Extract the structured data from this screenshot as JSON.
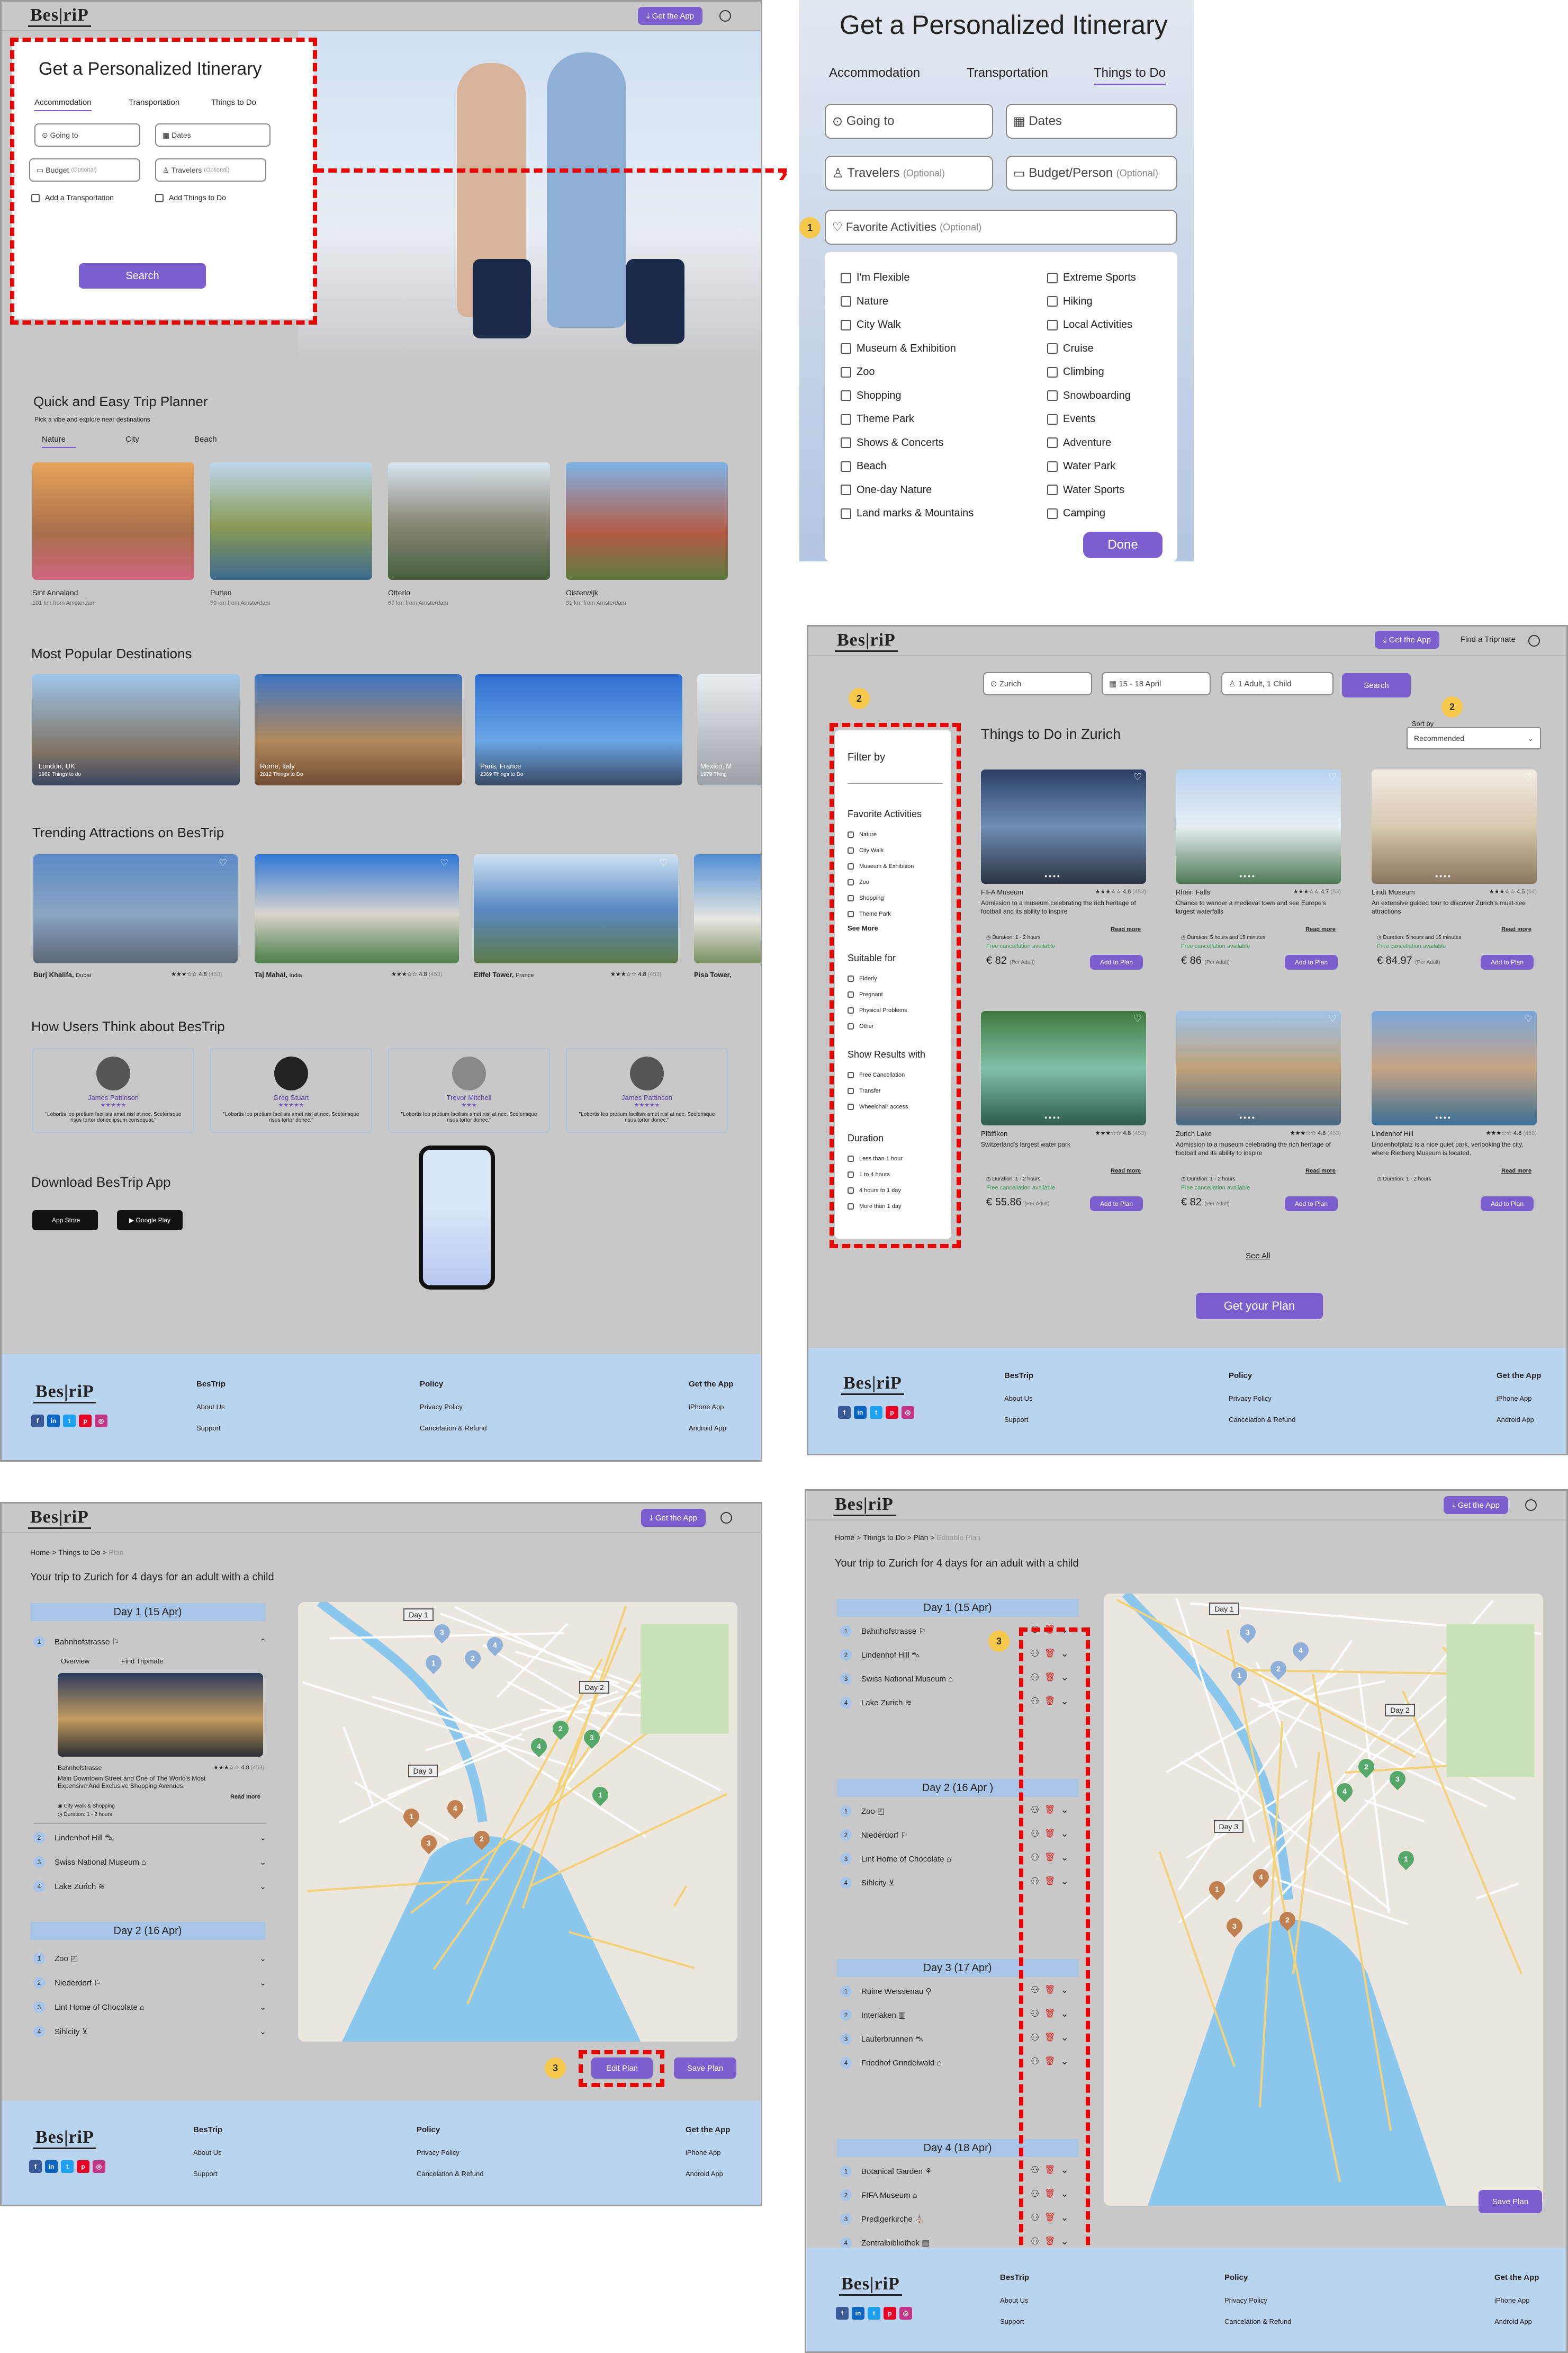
{
  "brand": {
    "logo": "Bes|riP",
    "accent": "#7b5fce",
    "light_blue": "#bad3ef"
  },
  "header": {
    "get_app": "Get the App",
    "find_tripmate": "Find a Tripmate"
  },
  "footer": {
    "col1_title": "BesTrip",
    "about": "About Us",
    "support": "Support",
    "col2_title": "Policy",
    "privacy": "Privacy Policy",
    "cancel": "Cancelation & Refund",
    "col3_title": "Get the App",
    "iphone": "iPhone App",
    "android": "Android App"
  },
  "home": {
    "itinerary_title": "Get a Personalized Itinerary",
    "tabs": [
      "Accommodation",
      "Transportation",
      "Things to Do"
    ],
    "going_to": "Going to",
    "dates": "Dates",
    "budget": "Budget",
    "budget_opt": "(Optional)",
    "travelers": "Travelers",
    "travelers_opt": "(Optional)",
    "add_transport": "Add a Transportation",
    "add_things": "Add Things to Do",
    "search": "Search",
    "quick_title": "Quick and Easy Trip Planner",
    "quick_sub": "Pick a vibe and explore near destinations",
    "vibes": [
      "Nature",
      "City",
      "Beach"
    ],
    "nearby": [
      {
        "name": "Sint Annaland",
        "dist": "101 km from Amsterdam"
      },
      {
        "name": "Putten",
        "dist": "59 km from Amsterdam"
      },
      {
        "name": "Otterlo",
        "dist": "67 km from Amsterdam"
      },
      {
        "name": "Oisterwijk",
        "dist": "91 km from Amsterdam"
      }
    ],
    "popular_title": "Most Popular Destinations",
    "popular": [
      {
        "name": "London, UK",
        "sub": "1969 Things to do"
      },
      {
        "name": "Rome, Italy",
        "sub": "2812 Things to Do"
      },
      {
        "name": "Paris, France",
        "sub": "2369 Things to Do"
      },
      {
        "name": "Mexico, M",
        "sub": "1979 Thing"
      }
    ],
    "trending_title": "Trending Attractions on BesTrip",
    "trending": [
      {
        "name": "Burj Khalifa,",
        "place": "Dubai",
        "rating": "4.8",
        "count": "(453)"
      },
      {
        "name": "Taj Mahal,",
        "place": "India",
        "rating": "4.8",
        "count": "(453)"
      },
      {
        "name": "Eiffel Tower,",
        "place": "France",
        "rating": "4.8",
        "count": "(453)"
      },
      {
        "name": "Pisa Tower,",
        "place": "",
        "rating": "",
        "count": ""
      }
    ],
    "users_title": "How Users Think about BesTrip",
    "users": [
      {
        "name": "James Pattinson",
        "quote": "\"Lobortis leo pretium facilisis amet nisl at nec. Scelerisque risus tortor donec ipsum consequat.\""
      },
      {
        "name": "Greg Stuart",
        "quote": "\"Lobortis leo pretium facilisis amet nisl at nec. Scelerisque risus tortor donec.\""
      },
      {
        "name": "Trevor Mitchell",
        "quote": "\"Lobortis leo pretium facilisis amet nisl at nec. Scelerisque risus tortor donec.\""
      },
      {
        "name": "James Pattinson",
        "quote": "\"Lobortis leo pretium facilisis amet nisl at nec. Scelerisque risus tortor donec.\""
      }
    ],
    "download_title": "Download BesTrip App",
    "appstore": "App Store",
    "googleplay": "Google Play"
  },
  "zoom": {
    "title": "Get a Personalized Itinerary",
    "tabs": [
      "Accommodation",
      "Transportation",
      "Things to Do"
    ],
    "going_to": "Going to",
    "dates": "Dates",
    "travelers": "Travelers",
    "travelers_opt": "(Optional)",
    "budget": "Budget/Person",
    "budget_opt": "(Optional)",
    "fav": "Favorite Activities",
    "fav_opt": "(Optional)",
    "badge": "1",
    "left": [
      "I'm Flexible",
      "Nature",
      "City Walk",
      "Museum & Exhibition",
      "Zoo",
      "Shopping",
      "Theme Park",
      "Shows & Concerts",
      "Beach",
      "One-day Nature",
      "Land marks & Mountains"
    ],
    "right": [
      "Extreme Sports",
      "Hiking",
      "Local Activities",
      "Cruise",
      "Climbing",
      "Snowboarding",
      "Events",
      "Adventure",
      "Water Park",
      "Water Sports",
      "Camping"
    ],
    "done": "Done"
  },
  "things": {
    "search_place": "Zurich",
    "search_dates": "15 - 18 April",
    "search_people": "1 Adult, 1 Child",
    "search": "Search",
    "badge": "2",
    "sort_label": "Sort by",
    "sort_value": "Recommended",
    "filter_title": "Filter by",
    "fav_title": "Favorite Activities",
    "fav": [
      "Nature",
      "City Walk",
      "Museum & Exhibition",
      "Zoo",
      "Shopping",
      "Theme Park"
    ],
    "see_more": "See More",
    "suit_title": "Suitable for",
    "suit": [
      "Elderly",
      "Pregnant",
      "Physical Problems",
      "Other"
    ],
    "show_title": "Show Results with",
    "show": [
      "Free Cancellation",
      "Transfer",
      "Wheelchair access"
    ],
    "dur_title": "Duration",
    "dur": [
      "Less than 1 hour",
      "1 to 4 hours",
      "4 hours to 1 day",
      "More than 1 day"
    ],
    "title": "Things to Do in Zurich",
    "cards": [
      {
        "name": "FIFA Museum",
        "rating": "4.8",
        "count": "(453)",
        "desc": "Admission to a museum celebrating the rich heritage of football and its ability to inspire",
        "dur": "Duration: 1 - 2 hours",
        "cancel": "Free cancellation available",
        "price": "€ 82",
        "per": "(Per Adult)"
      },
      {
        "name": "Rhein Falls",
        "rating": "4.7",
        "count": "(53)",
        "desc": "Chance to wander a medieval town and see Europe's largest waterfalls",
        "dur": "Duration: 5 hours and 15 minutes",
        "cancel": "Free cancellation available",
        "price": "€ 86",
        "per": "(Per Adult)"
      },
      {
        "name": "Lindt Museum",
        "rating": "4.5",
        "count": "(94)",
        "desc": "An extensive guided tour to discover Zurich's must-see attractions",
        "dur": "Duration: 5 hours and 15 minutes",
        "cancel": "Free cancellation available",
        "price": "€ 84.97",
        "per": "(Per Adult)"
      },
      {
        "name": "Pfäffikon",
        "rating": "4.8",
        "count": "(453)",
        "desc": "Switzerland's largest water park",
        "dur": "Duration: 1 - 2 hours",
        "cancel": "Free cancellation available",
        "price": "€ 55.86",
        "per": "(Per Adult)"
      },
      {
        "name": "Zurich Lake",
        "rating": "4.8",
        "count": "(453)",
        "desc": "Admission to a museum celebrating the rich heritage of football and its ability to inspire",
        "dur": "Duration: 1 - 2 hours",
        "cancel": "Free cancellation available",
        "price": "€ 82",
        "per": "(Per Adult)"
      },
      {
        "name": "Lindenhof Hill",
        "rating": "4.8",
        "count": "(453)",
        "desc": "Lindenhofplatz is a nice quiet park, verlooking the city, where Rietberg Museum is located.",
        "dur": "Duration: 1 - 2 hours",
        "cancel": "",
        "price": "",
        "per": ""
      }
    ],
    "read_more": "Read more",
    "add": "Add to Plan",
    "see_all": "See All",
    "get_plan": "Get your Plan"
  },
  "plan": {
    "crumbs": [
      "Home",
      "Things to Do",
      "Plan"
    ],
    "title": "Your trip to Zurich for 4 days for an adult with a child",
    "day1": "Day 1 (15 Apr)",
    "day2": "Day 2 (16 Apr)",
    "d1": [
      "Bahnhofstrasse",
      "Lindenhof Hill",
      "Swiss National Museum",
      "Lake Zurich"
    ],
    "d2": [
      "Zoo",
      "Niederdorf",
      "Lint Home of Chocolate",
      "Sihlcity"
    ],
    "overview": "Overview",
    "find_tripmate": "Find Tripmate",
    "detail_name": "Bahnhofstrasse",
    "detail_rating": "4.8",
    "detail_count": "(453)",
    "detail_desc": "Main Downtown Street and One of The World's Most Expensive And Exclusive Shopping Avenues.",
    "detail_tags": "City Walk & Shopping",
    "detail_dur": "Duration: 1 - 2 hours",
    "read_more": "Read more",
    "edit": "Edit Plan",
    "save": "Save Plan",
    "badge": "3",
    "day_labels": [
      "Day 1",
      "Day 2",
      "Day 3"
    ]
  },
  "edit": {
    "crumbs": [
      "Home",
      "Things to Do",
      "Plan",
      "Editable Plan"
    ],
    "title": "Your trip to Zurich for 4 days for an adult with a child",
    "days": [
      {
        "label": "Day 1 (15 Apr)",
        "items": [
          "Bahnhofstrasse",
          "Lindenhof Hill",
          "Swiss National Museum",
          "Lake Zurich"
        ]
      },
      {
        "label": "Day 2 (16 Apr )",
        "items": [
          "Zoo",
          "Niederdorf",
          "Lint Home of Chocolate",
          "Sihlcity"
        ]
      },
      {
        "label": "Day 3 (17 Apr)",
        "items": [
          "Ruine Weissenau",
          "Interlaken",
          "Lauterbrunnen",
          "Friedhof Grindelwald"
        ]
      },
      {
        "label": "Day 4 (18 Apr)",
        "items": [
          "Botanical Garden",
          "FIFA Museum",
          "Predigerkirche",
          "Zentralbibliothek"
        ]
      }
    ],
    "save": "Save Plan",
    "badge": "3",
    "day_labels": [
      "Day 1",
      "Day 2",
      "Day 3"
    ]
  }
}
